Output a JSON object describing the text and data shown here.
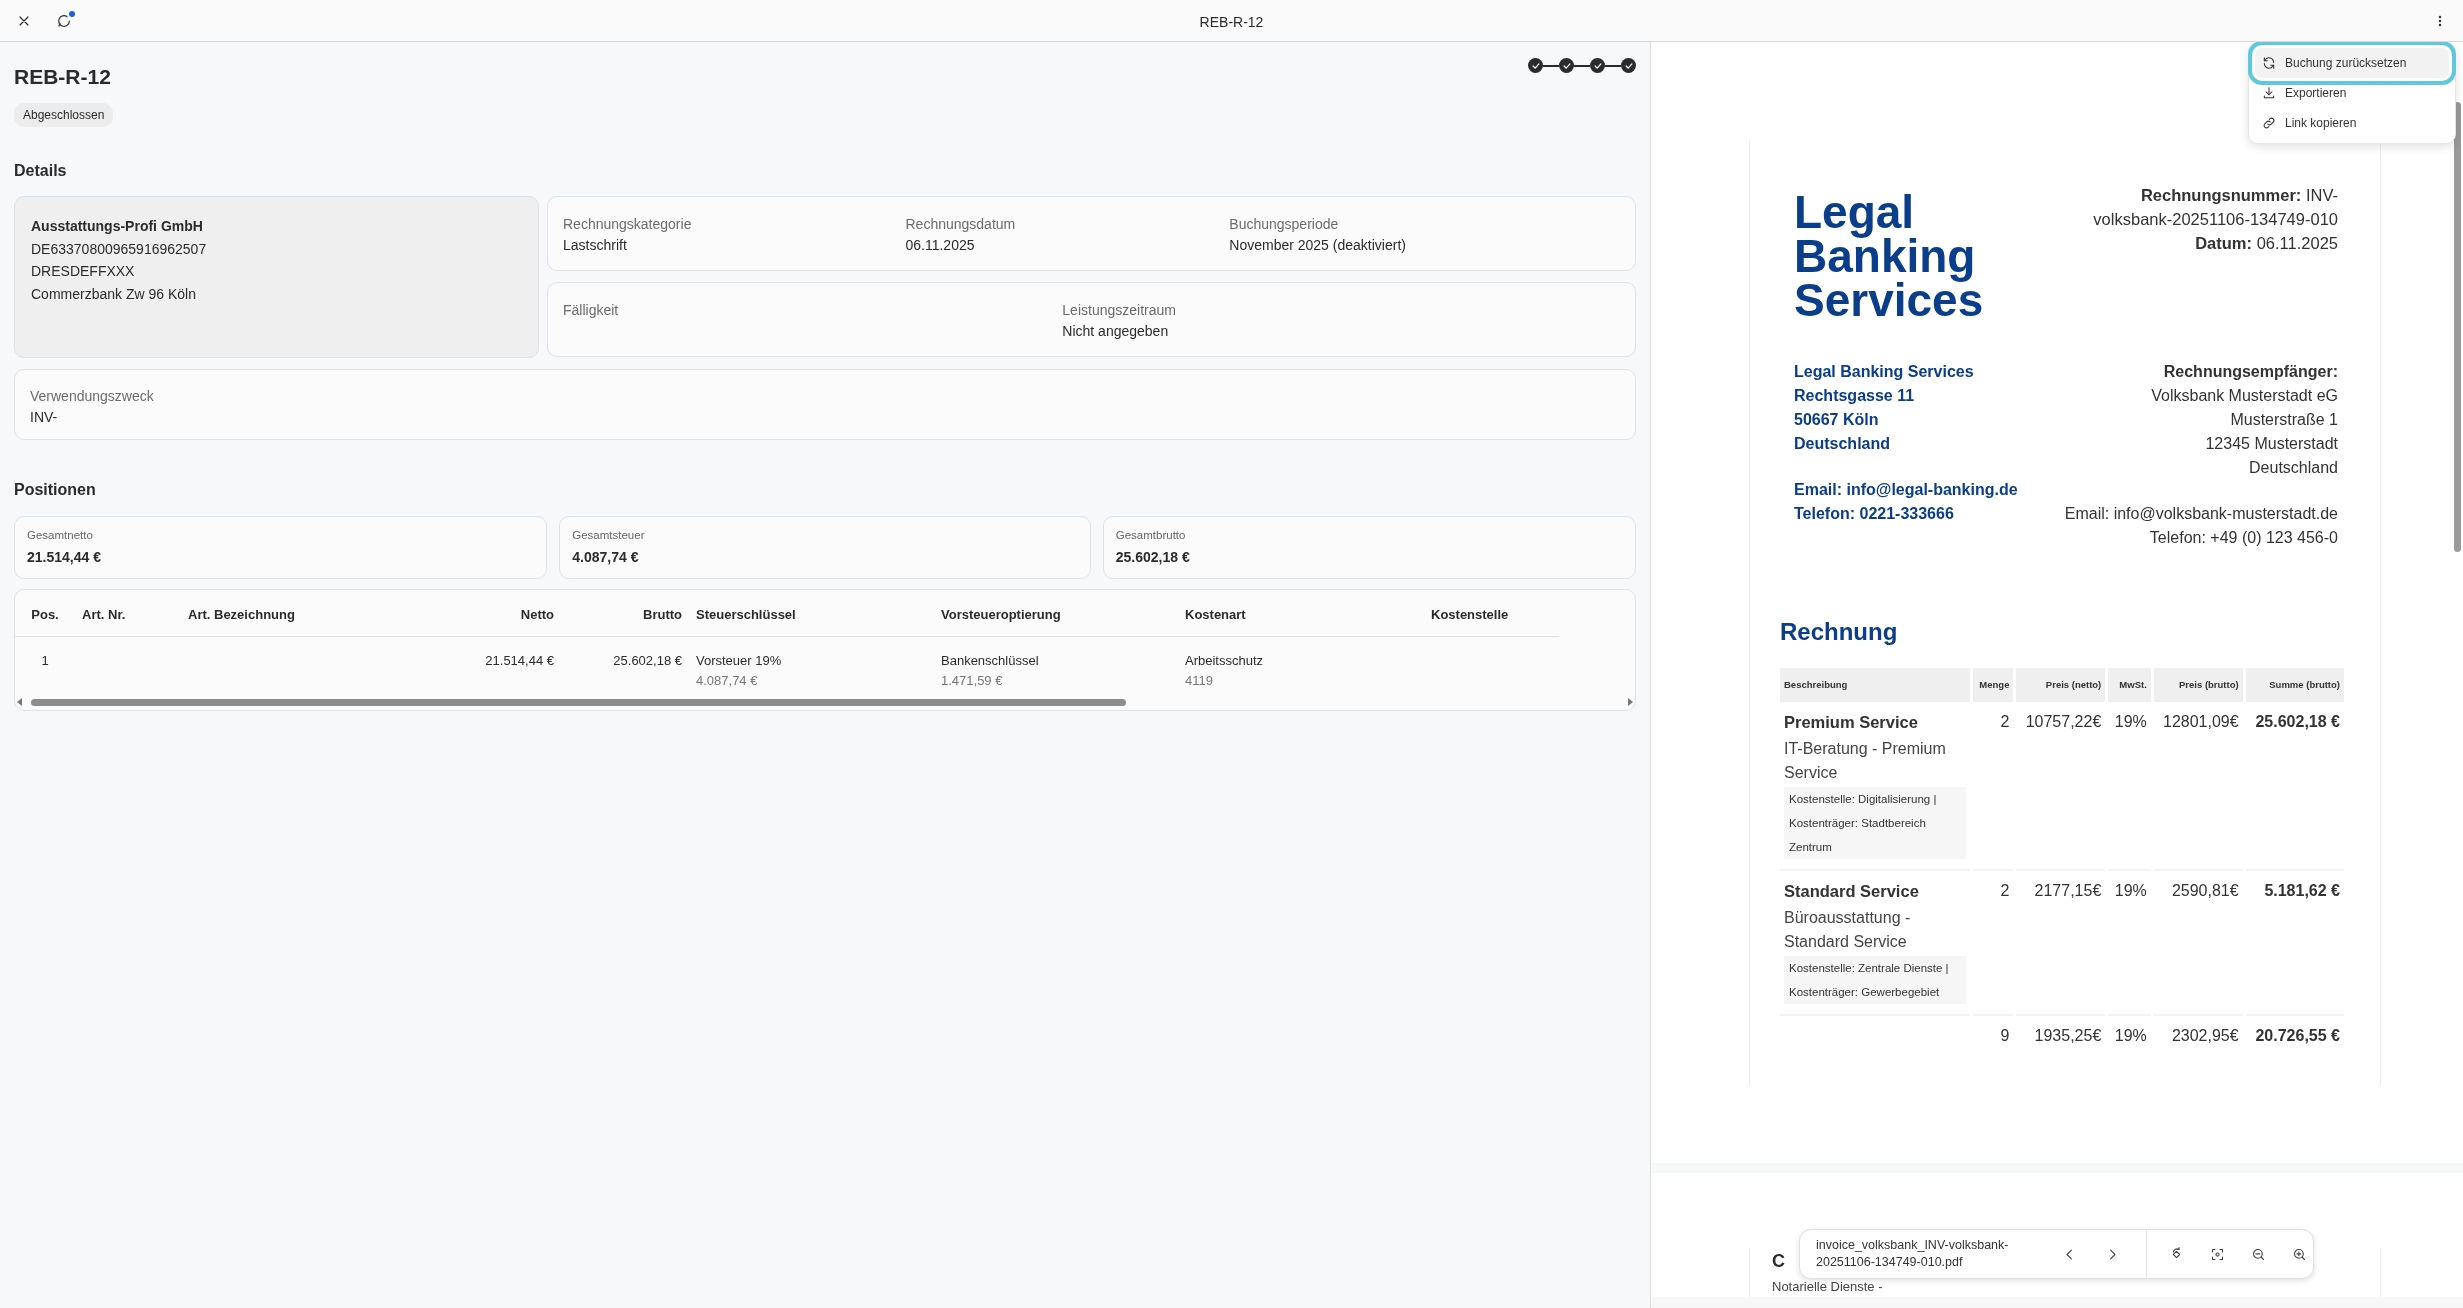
{
  "topbar": {
    "title": "REB-R-12",
    "notification": true
  },
  "booking": {
    "title": "REB-R-12",
    "status": "Abgeschlossen",
    "steps": [
      {
        "done": true
      },
      {
        "done": true
      },
      {
        "done": true
      },
      {
        "done": true
      }
    ]
  },
  "details": {
    "heading": "Details",
    "account": {
      "name": "Ausstattungs-Profi GmbH",
      "lines": [
        "DE63370800965916962507",
        "DRESDEFFXXX",
        "Commerzbank Zw 96 Köln"
      ]
    },
    "field_groups": [
      [
        {
          "label": "Rechnungskategorie",
          "value": "Lastschrift"
        },
        {
          "label": "Rechnungsdatum",
          "value": "06.11.2025"
        },
        {
          "label": "Buchungsperiode",
          "value": "November 2025 (deaktiviert)"
        }
      ],
      [
        {
          "label": "Fälligkeit"
        },
        {
          "label": "Leistungszeitraum",
          "value": "Nicht angegeben"
        }
      ]
    ],
    "purpose": {
      "label": "Verwendungszweck",
      "value": "INV-"
    }
  },
  "positions": {
    "heading": "Positionen",
    "totals": [
      {
        "label": "Gesamtnetto",
        "value": "21.514,44 €"
      },
      {
        "label": "Gesamtsteuer",
        "value": "4.087,74 €"
      },
      {
        "label": "Gesamtbrutto",
        "value": "25.602,18 €"
      }
    ],
    "table": {
      "columns": [
        {
          "label": "Pos."
        },
        {
          "label": "Art. Nr."
        },
        {
          "label": "Art. Bezeichnung"
        },
        {
          "label": "Netto"
        },
        {
          "label": "Brutto"
        },
        {
          "label": "Steuerschlüssel"
        },
        {
          "label": "Vorsteueroptierung"
        },
        {
          "label": "Kostenart"
        },
        {
          "label": "Kostenstelle"
        }
      ],
      "rows": [
        {
          "cells": [
            {
              "text": "1"
            },
            null,
            null,
            {
              "text": "21.514,44 €"
            },
            {
              "text": "25.602,18 €"
            },
            {
              "text": "Vorsteuer 19%",
              "sub": "4.087,74 €"
            },
            {
              "text": "Bankenschlüssel",
              "sub": "1.471,59 €"
            },
            {
              "text": "Arbeitsschutz",
              "sub": "4119"
            },
            null
          ]
        }
      ]
    }
  },
  "menu": {
    "items": [
      {
        "label": "Buchung zurücksetzen",
        "selected": true
      },
      {
        "label": "Exportieren",
        "selected": false
      },
      {
        "label": "Link kopieren",
        "selected": false
      }
    ]
  },
  "invoice": {
    "brand_lines": [
      "Legal",
      "Banking",
      "Services"
    ],
    "meta_lines": [
      "**Rechnungsnummer:** INV-",
      "volksbank-20251106-134749-010",
      "**Datum:** 06.11.2025"
    ],
    "sender": {
      "address": [
        "Legal Banking Services",
        "Rechtsgasse 11",
        "50667 Köln",
        "Deutschland"
      ],
      "contact": [
        "Email: info@legal-banking.de",
        "Telefon: 0221-333666"
      ]
    },
    "recipient": {
      "heading": "Rechnungsempfänger:",
      "address": [
        "Volksbank Musterstadt eG",
        "Musterstraße 1",
        "12345 Musterstadt",
        "Deutschland"
      ],
      "contact": [
        "Email: info@volksbank-musterstadt.de",
        "Telefon: +49 (0) 123 456-0"
      ]
    },
    "heading": "Rechnung",
    "columns": [
      "Beschreibung",
      "Menge",
      "Preis (netto)",
      "MwSt.",
      "Preis (brutto)",
      "Summe (brutto)"
    ],
    "items": [
      {
        "title": "Premium Service",
        "description": "IT-Beratung - Premium Service",
        "note": "Kostenstelle: Digitalisierung | Kostenträger: Stadtbereich Zentrum",
        "quantity": "2",
        "net": "10757,22€",
        "vat": "19%",
        "gross": "12801,09€",
        "total": "25.602,18 €"
      },
      {
        "title": "Standard Service",
        "description": "Büroausstattung - Standard Service",
        "note": "Kostenstelle: Zentrale Dienste | Kostenträger: Gewerbegebiet",
        "quantity": "2",
        "net": "2177,15€",
        "vat": "19%",
        "gross": "2590,81€",
        "total": "5.181,62 €"
      },
      {
        "quantity": "9",
        "net": "1935,25€",
        "vat": "19%",
        "gross": "2302,95€",
        "total": "20.726,55 €"
      }
    ],
    "next_page": {
      "heading": "C",
      "text": "Notarielle Dienste -"
    }
  },
  "viewer": {
    "filename": "invoice_volksbank_INV-volksbank-20251106-134749-010.pdf"
  }
}
